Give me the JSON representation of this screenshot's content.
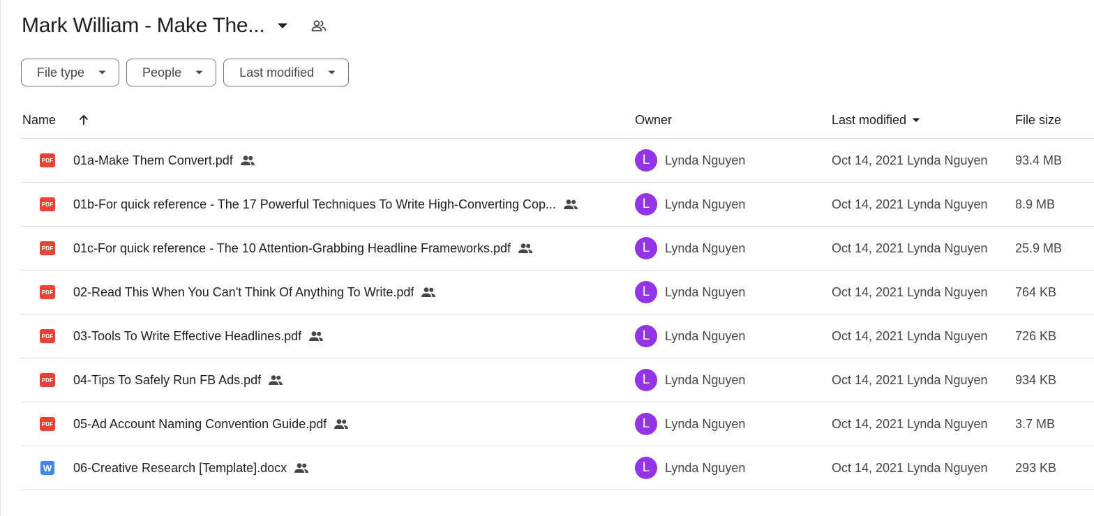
{
  "header": {
    "title": "Mark William - Make The...",
    "title_caret_icon": "caret-down-icon",
    "share_icon": "people-outline-icon"
  },
  "filters": [
    {
      "label": "File type",
      "icon": "caret-down-icon"
    },
    {
      "label": "People",
      "icon": "caret-down-icon"
    },
    {
      "label": "Last modified",
      "icon": "caret-down-icon"
    }
  ],
  "columns": {
    "name": "Name",
    "owner": "Owner",
    "last_modified": "Last modified",
    "file_size": "File size",
    "sort_icon": "arrow-up-icon",
    "modified_sort_icon": "caret-down-icon"
  },
  "files": [
    {
      "type": "pdf",
      "name": "01a-Make Them Convert.pdf",
      "owner_initial": "L",
      "owner": "Lynda Nguyen",
      "modified": "Oct 14, 2021 Lynda Nguyen",
      "size": "93.4 MB"
    },
    {
      "type": "pdf",
      "name": "01b-For quick reference - The 17 Powerful Techniques To Write High-Converting Cop...",
      "owner_initial": "L",
      "owner": "Lynda Nguyen",
      "modified": "Oct 14, 2021 Lynda Nguyen",
      "size": "8.9 MB"
    },
    {
      "type": "pdf",
      "name": "01c-For quick reference - The 10 Attention-Grabbing Headline Frameworks.pdf",
      "owner_initial": "L",
      "owner": "Lynda Nguyen",
      "modified": "Oct 14, 2021 Lynda Nguyen",
      "size": "25.9 MB"
    },
    {
      "type": "pdf",
      "name": "02-Read This When You Can't Think Of Anything To Write.pdf",
      "owner_initial": "L",
      "owner": "Lynda Nguyen",
      "modified": "Oct 14, 2021 Lynda Nguyen",
      "size": "764 KB"
    },
    {
      "type": "pdf",
      "name": "03-Tools To Write Effective Headlines.pdf",
      "owner_initial": "L",
      "owner": "Lynda Nguyen",
      "modified": "Oct 14, 2021 Lynda Nguyen",
      "size": "726 KB"
    },
    {
      "type": "pdf",
      "name": "04-Tips To Safely Run FB Ads.pdf",
      "owner_initial": "L",
      "owner": "Lynda Nguyen",
      "modified": "Oct 14, 2021 Lynda Nguyen",
      "size": "934 KB"
    },
    {
      "type": "pdf",
      "name": "05-Ad Account Naming Convention Guide.pdf",
      "owner_initial": "L",
      "owner": "Lynda Nguyen",
      "modified": "Oct 14, 2021 Lynda Nguyen",
      "size": "3.7 MB"
    },
    {
      "type": "docx",
      "name": "06-Creative Research [Template].docx",
      "owner_initial": "L",
      "owner": "Lynda Nguyen",
      "modified": "Oct 14, 2021 Lynda Nguyen",
      "size": "293 KB"
    }
  ],
  "badges": {
    "pdf": "PDF",
    "docx": "W"
  },
  "colors": {
    "avatar": "#9334e6",
    "pdf_icon": "#ea4335",
    "docx_icon": "#4285f4"
  }
}
